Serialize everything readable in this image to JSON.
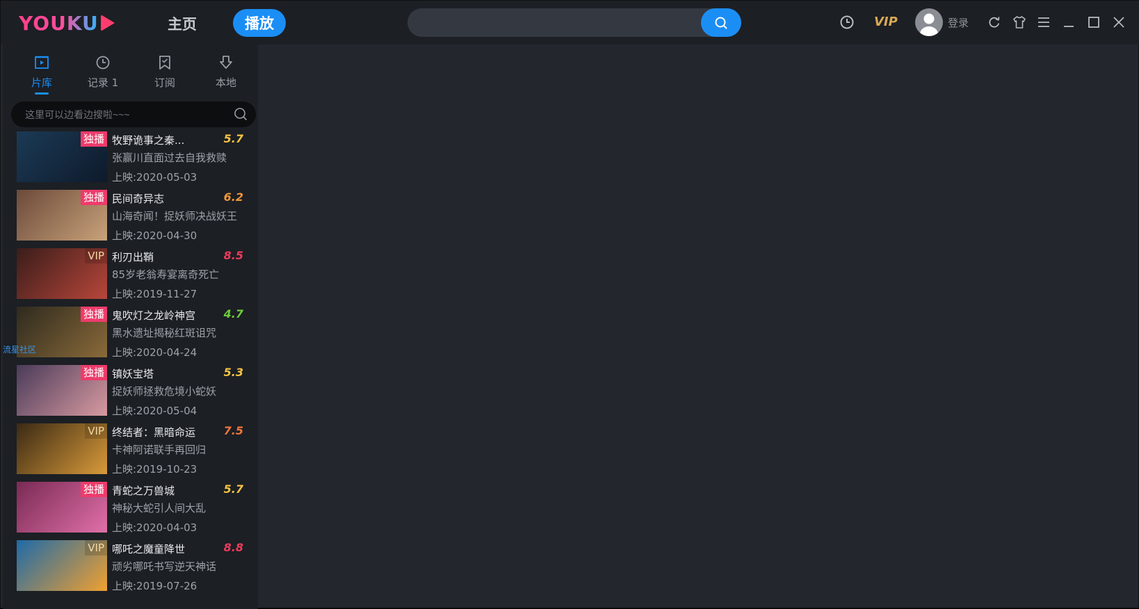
{
  "logo": {
    "text": "YOUKU"
  },
  "nav": {
    "home": "主页",
    "play": "播放"
  },
  "search": {
    "value": ""
  },
  "header": {
    "vip": "VIP",
    "login": "登录"
  },
  "tabs": [
    {
      "label": "片库",
      "active": true
    },
    {
      "label": "记录 1",
      "active": false
    },
    {
      "label": "订阅",
      "active": false
    },
    {
      "label": "本地",
      "active": false
    }
  ],
  "sidebar_search": {
    "placeholder": "这里可以边看边搜啦~~~"
  },
  "float_link": "流星社区",
  "items": [
    {
      "badge": "独播",
      "badge_type": "excl",
      "title": "牧野诡事之秦...",
      "score": "5.7",
      "score_color": "#f5c242",
      "desc": "张赢川直面过去自我救赎",
      "date": "上映:2020-05-03",
      "thumb": [
        "#1b3a55",
        "#0e1a2b"
      ]
    },
    {
      "badge": "独播",
      "badge_type": "excl",
      "title": "民间奇异志",
      "score": "6.2",
      "score_color": "#f0963c",
      "desc": "山海奇闻！捉妖师决战妖王",
      "date": "上映:2020-04-30",
      "thumb": [
        "#6b4a3a",
        "#c9a27a"
      ]
    },
    {
      "badge": "VIP",
      "badge_type": "vip",
      "title": "利刃出鞘",
      "score": "8.5",
      "score_color": "#ee3b5b",
      "desc": "85岁老翁寿宴离奇死亡",
      "date": "上映:2019-11-27",
      "thumb": [
        "#3a1d1a",
        "#b8463a"
      ]
    },
    {
      "badge": "独播",
      "badge_type": "excl",
      "title": "鬼吹灯之龙岭神宫",
      "score": "4.7",
      "score_color": "#6ccc3b",
      "desc": "黑水遗址揭秘红斑诅咒",
      "date": "上映:2020-04-24",
      "thumb": [
        "#2e2a1e",
        "#8a6a3a"
      ]
    },
    {
      "badge": "独播",
      "badge_type": "excl",
      "title": "镇妖宝塔",
      "score": "5.3",
      "score_color": "#f5c242",
      "desc": "捉妖师拯救危境小蛇妖",
      "date": "上映:2020-05-04",
      "thumb": [
        "#4a3b5a",
        "#d89aa0"
      ]
    },
    {
      "badge": "VIP",
      "badge_type": "vip",
      "title": "终结者：黑暗命运",
      "score": "7.5",
      "score_color": "#f0763c",
      "desc": "卡神阿诺联手再回归",
      "date": "上映:2019-10-23",
      "thumb": [
        "#3a2a14",
        "#d99a3a"
      ]
    },
    {
      "badge": "独播",
      "badge_type": "excl",
      "title": "青蛇之万兽城",
      "score": "5.7",
      "score_color": "#f5c242",
      "desc": "神秘大蛇引人间大乱",
      "date": "上映:2020-04-03",
      "thumb": [
        "#7a2a55",
        "#e070a8"
      ]
    },
    {
      "badge": "VIP",
      "badge_type": "vip",
      "title": "哪吒之魔童降世",
      "score": "8.8",
      "score_color": "#ee3b5b",
      "desc": "顽劣哪吒书写逆天神话",
      "date": "上映:2019-07-26",
      "thumb": [
        "#1e6aa8",
        "#f0a030"
      ]
    }
  ]
}
